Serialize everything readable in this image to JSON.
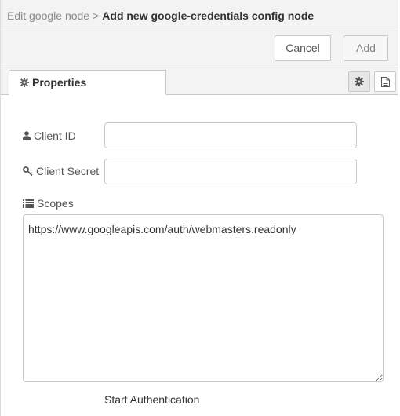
{
  "header": {
    "breadcrumb_parent": "Edit google node",
    "breadcrumb_sep": ">",
    "title": "Add new google-credentials config node"
  },
  "toolbar": {
    "cancel_label": "Cancel",
    "add_label": "Add"
  },
  "tabs": {
    "properties_label": "Properties",
    "settings_icon": "gear-icon",
    "description_icon": "document-icon"
  },
  "form": {
    "client_id": {
      "label": "Client ID",
      "icon": "user-icon",
      "value": ""
    },
    "client_secret": {
      "label": "Client Secret",
      "icon": "key-icon",
      "value": ""
    },
    "scopes": {
      "label": "Scopes",
      "icon": "list-icon",
      "value": "https://www.googleapis.com/auth/webmasters.readonly"
    },
    "start_auth_label": "Start Authentication"
  }
}
